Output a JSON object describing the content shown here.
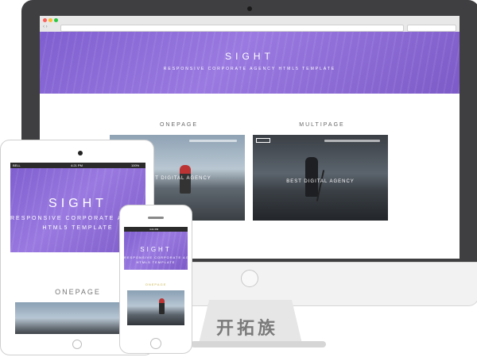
{
  "desktop": {
    "hero": {
      "title": "SIGHT",
      "subtitle": "RESPONSIVE CORPORATE AGENCY HTML5 TEMPLATE"
    },
    "sections": {
      "onepage_label": "ONEPAGE",
      "multipage_label": "MULTIPAGE"
    },
    "onepage_preview": {
      "caption": "BEST DIGITAL AGENCY"
    },
    "multipage_preview": {
      "caption": "BEST DIGITAL AGENCY"
    }
  },
  "tablet": {
    "status": {
      "carrier": "BELL",
      "time": "4:21 PM",
      "battery": "100%"
    },
    "hero": {
      "title": "SIGHT",
      "subtitle_line1": "RESPONSIVE CORPORATE AGENCY",
      "subtitle_line2": "HTML5 TEMPLATE"
    },
    "onepage_label": "ONEPAGE"
  },
  "phone": {
    "status": {
      "time": "4:21 PM"
    },
    "hero": {
      "title": "SIGHT",
      "subtitle_line1": "RESPONSIVE CORPORATE AGENCY",
      "subtitle_line2": "HTML5 TEMPLATE"
    },
    "onepage_label": "ONEPAGE"
  },
  "watermark": "开拓族",
  "colors": {
    "hero_purple": "#8a6ad6",
    "monitor_frame": "#3f3f41"
  }
}
